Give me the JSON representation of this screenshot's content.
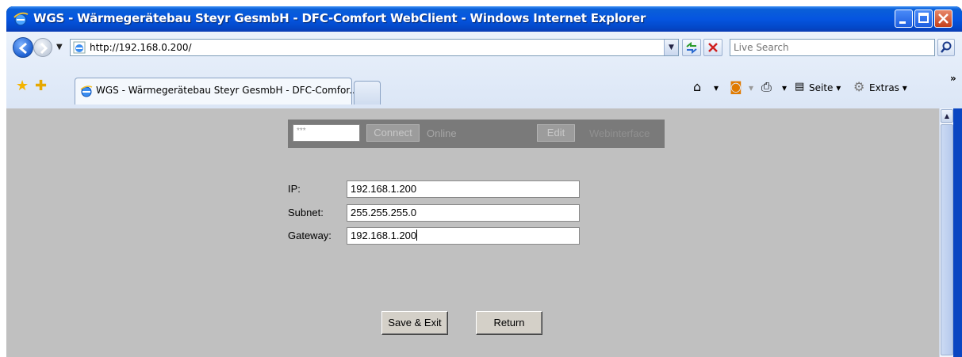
{
  "window": {
    "title": "WGS - Wärmegerätebau Steyr GesmbH - DFC-Comfort WebClient - Windows Internet Explorer"
  },
  "browser": {
    "address": "http://192.168.0.200/",
    "search_placeholder": "Live Search",
    "tab_title": "WGS - Wärmegerätebau Steyr GesmbH - DFC-Comfor...",
    "commands": {
      "page": "Seite",
      "tools": "Extras"
    }
  },
  "page": {
    "topbar": {
      "password_value": "***",
      "connect_label": "Connect",
      "status_label": "Online",
      "edit_label": "Edit",
      "title": "Webinterface"
    },
    "form": {
      "ip_label": "IP:",
      "ip_value": "192.168.1.200",
      "subnet_label": "Subnet:",
      "subnet_value": "255.255.255.0",
      "gateway_label": "Gateway:",
      "gateway_value": "192.168.1.200"
    },
    "buttons": {
      "save_exit": "Save & Exit",
      "return": "Return"
    }
  },
  "colors": {
    "titlebar": "#0555e0",
    "page_background": "#c0c0c0",
    "topbar_background": "#7a7a7a"
  }
}
